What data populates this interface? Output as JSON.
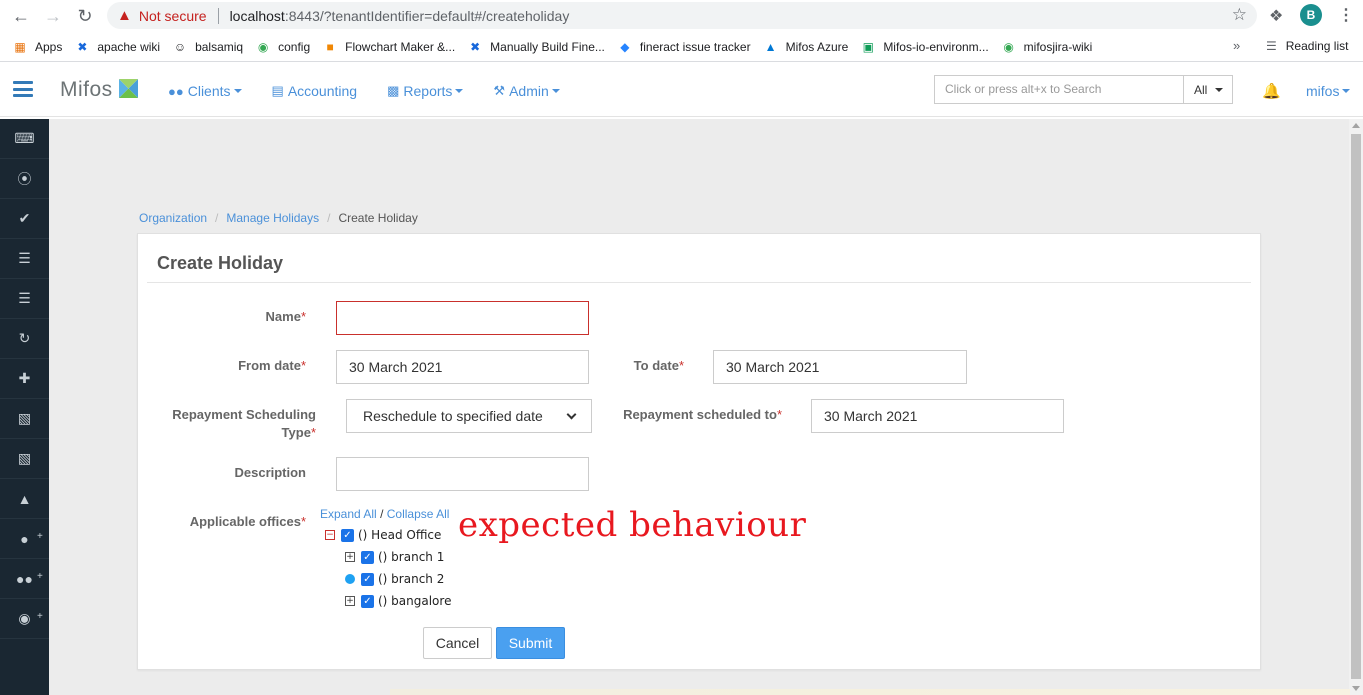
{
  "browser": {
    "security_label": "Not secure",
    "url_host": "localhost",
    "url_rest": ":8443/?tenantIdentifier=default#/createholiday",
    "profile_initial": "B",
    "bookmarks": [
      "Apps",
      "apache wiki",
      "balsamiq",
      "config",
      "Flowchart Maker &...",
      "Manually Build Fine...",
      "fineract issue tracker",
      "Mifos Azure",
      "Mifos-io-environm...",
      "mifosjira-wiki"
    ],
    "more_label": "»",
    "reading_list": "Reading list"
  },
  "app": {
    "brand": "Mifos",
    "nav": [
      "Clients",
      "Accounting",
      "Reports",
      "Admin"
    ],
    "search_placeholder": "Click or press alt+x to Search",
    "search_scope": "All",
    "user": "mifos"
  },
  "breadcrumb": {
    "items": [
      "Organization",
      "Manage Holidays"
    ],
    "current": "Create Holiday"
  },
  "form": {
    "title": "Create Holiday",
    "name_label": "Name",
    "name_value": "",
    "from_label": "From date",
    "from_value": "30 March 2021",
    "to_label": "To date",
    "to_value": "30 March 2021",
    "sched_type_label_1": "Repayment Scheduling",
    "sched_type_label_2": "Type",
    "sched_type_value": "Reschedule to specified date",
    "sched_to_label": "Repayment scheduled to",
    "sched_to_value": "30 March 2021",
    "description_label": "Description",
    "description_value": "",
    "offices_label": "Applicable offices",
    "expand_all": "Expand All",
    "slash": "/",
    "collapse_all": "Collapse All",
    "required_mark": "*",
    "offices": [
      "() Head Office",
      "() branch 1",
      "() branch 2",
      "() bangalore"
    ],
    "cancel": "Cancel",
    "submit": "Submit"
  },
  "annotation": "expected behaviour",
  "colors": {
    "accent": "#4a90d9",
    "sidebar": "#1a2732",
    "required": "#c9302c",
    "annotation": "#e8181f"
  }
}
